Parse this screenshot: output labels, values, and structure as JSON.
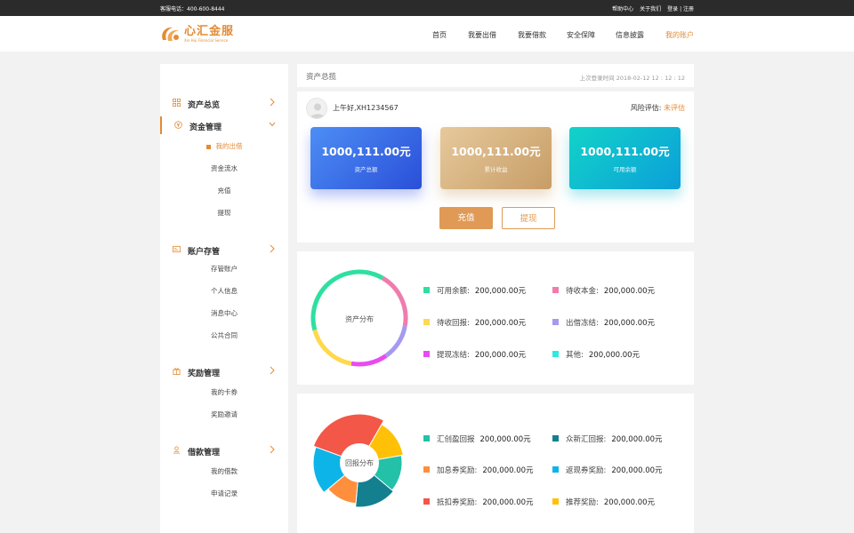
{
  "topbar": {
    "hotline": "客服电话：400-600-8444",
    "links": [
      "帮助中心",
      "关于我们",
      "登录 | 注册"
    ]
  },
  "logo": {
    "cn": "心汇金服",
    "en": "Xin Hui Financial Service"
  },
  "nav": {
    "items": [
      "首页",
      "我要出借",
      "我要借款",
      "安全保障",
      "信息披露",
      "我的账户"
    ],
    "active_color": "#e38b35"
  },
  "sidebar": {
    "groups": [
      {
        "label": "资产总览",
        "icon": "grid-icon",
        "subs": []
      },
      {
        "label": "资金管理",
        "icon": "yen-icon",
        "subs": [
          "我的出借",
          "资金流水",
          "充值",
          "提现"
        ]
      },
      {
        "label": "账户存管",
        "icon": "card-icon",
        "subs": [
          "存管账户",
          "个人信息",
          "消息中心",
          "公共合同"
        ]
      },
      {
        "label": "奖励管理",
        "icon": "gift-icon",
        "subs": [
          "我的卡券",
          "奖励邀请"
        ]
      },
      {
        "label": "借款管理",
        "icon": "loan-icon",
        "subs": [
          "我的借款",
          "申请记录"
        ]
      }
    ]
  },
  "overview": {
    "title": "资产总揽",
    "last_login": "上次登录时间  2018-02-12  12 : 12 : 12",
    "greeting": "上午好,XH1234567",
    "risk_label": "风险评估:",
    "risk_value": "未评估",
    "cards": [
      {
        "amount": "1000,111.00元",
        "label": "资产总额"
      },
      {
        "amount": "1000,111.00元",
        "label": "累计收益"
      },
      {
        "amount": "1000,111.00元",
        "label": "可用余额"
      }
    ],
    "recharge": "充值",
    "withdraw": "提现"
  },
  "asset_dist": {
    "center": "资产分布",
    "items": [
      {
        "label": "可用余额:",
        "value": "200,000.00元",
        "color": "#2ee0a0"
      },
      {
        "label": "待收本金:",
        "value": "200,000.00元",
        "color": "#f07cae"
      },
      {
        "label": "待收回报:",
        "value": "200,000.00元",
        "color": "#ffd84d"
      },
      {
        "label": "出借冻结:",
        "value": "200,000.00元",
        "color": "#a59af0"
      },
      {
        "label": "提现冻结:",
        "value": "200,000.00元",
        "color": "#e84bf0"
      },
      {
        "label": "其他:",
        "value": "200,000.00元",
        "color": "#2eeae0"
      }
    ]
  },
  "return_dist": {
    "center": "回报分布",
    "items": [
      {
        "label": "汇创盈回报",
        "value": "200,000.00元",
        "color": "#22c1a8"
      },
      {
        "label": "众新汇回报:",
        "value": "200,000.00元",
        "color": "#14808f"
      },
      {
        "label": "加息券奖励:",
        "value": "200,000.00元",
        "color": "#ff8f3d"
      },
      {
        "label": "返现券奖励:",
        "value": "200,000.00元",
        "color": "#0db4e8"
      },
      {
        "label": "抵扣券奖励:",
        "value": "200,000.00元",
        "color": "#f25748"
      },
      {
        "label": "推荐奖励:",
        "value": "200,000.00元",
        "color": "#ffc107"
      }
    ]
  }
}
